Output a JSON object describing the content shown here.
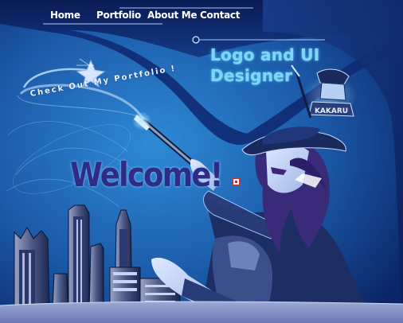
{
  "nav": {
    "home": "Home",
    "portfolio": "Portfolio",
    "about": "About Me",
    "contact": "Contact"
  },
  "headline": {
    "line1": "Logo and UI",
    "line2": "Designer"
  },
  "cta": {
    "portfolio_link": "Check Out My Portfolio !"
  },
  "welcome": "Welcome!",
  "logo": {
    "text": "KAKARU"
  },
  "colors": {
    "background_deep": "#0b1f58",
    "background_mid": "#1b64b4",
    "accent_glow": "#7fd6f4",
    "welcome_text": "#2f2c86",
    "nav_text": "#ffffff"
  }
}
